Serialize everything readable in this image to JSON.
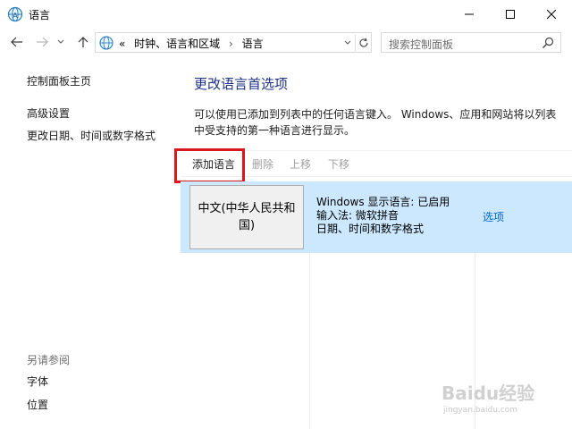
{
  "window": {
    "title": "语言"
  },
  "address": {
    "overflow": "«",
    "crumbs": [
      "时钟、语言和区域",
      "语言"
    ],
    "search_placeholder": "搜索控制面板"
  },
  "sidebar": {
    "home": "控制面板主页",
    "advanced": "高级设置",
    "datetime": "更改日期、时间或数字格式",
    "see_also": "另请参阅",
    "fonts": "字体",
    "location": "位置"
  },
  "main": {
    "title": "更改语言首选项",
    "description": "可以使用已添加到列表中的任何语言键入。 Windows、应用和网站将以列表中受支持的第一种语言进行显示。",
    "toolbar": {
      "add": "添加语言",
      "delete": "删除",
      "up": "上移",
      "down": "下移"
    },
    "languages": [
      {
        "name": "中文(中华人民共和国)",
        "details": [
          "Windows 显示语言: 已启用",
          "输入法: 微软拼音",
          "日期、时间和数字格式"
        ],
        "options": "选项"
      }
    ]
  },
  "watermark": {
    "brand": "Baidu经验",
    "url": "jingyan.baidu.com"
  },
  "colors": {
    "title_blue": "#1e3287",
    "link_blue": "#0066cc",
    "selected_row": "#cce8ff",
    "highlight_red": "#d7191c"
  }
}
